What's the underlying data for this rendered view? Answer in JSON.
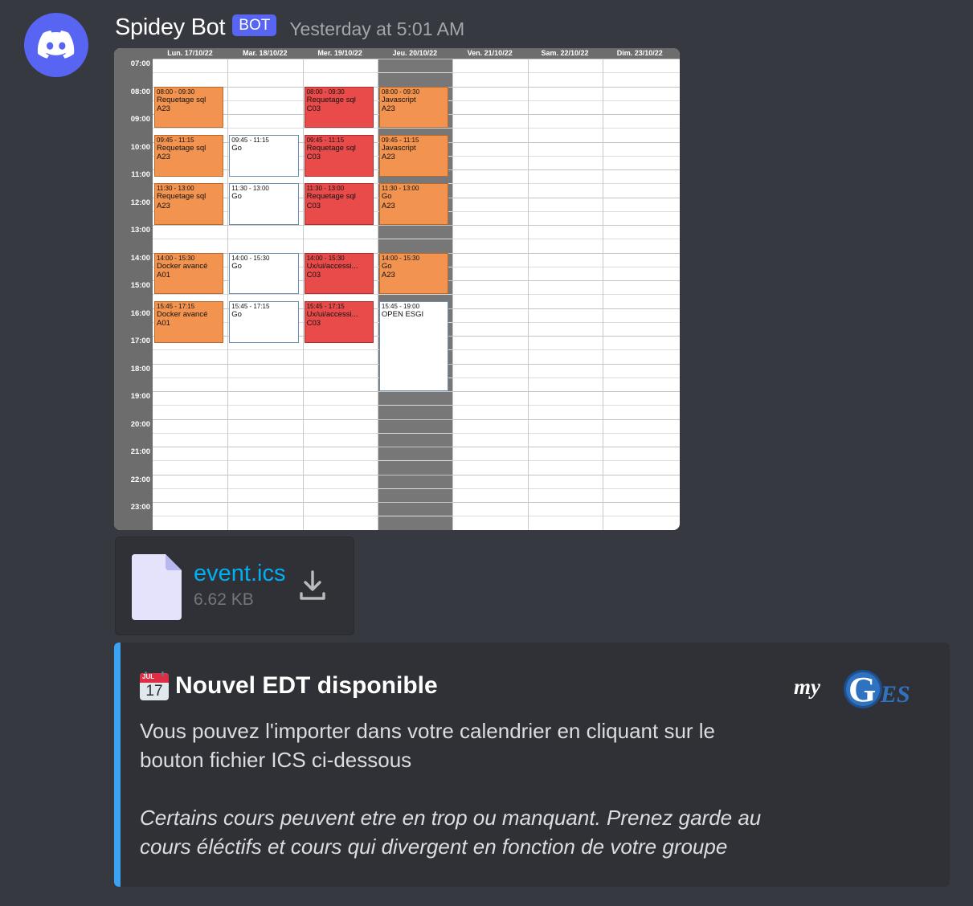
{
  "message": {
    "username": "Spidey Bot",
    "bot_tag": "BOT",
    "timestamp": "Yesterday at 5:01 AM",
    "avatar_icon": "discord-logo-icon"
  },
  "schedule": {
    "days": [
      "Lun. 17/10/22",
      "Mar. 18/10/22",
      "Mer. 19/10/22",
      "Jeu. 20/10/22",
      "Ven. 21/10/22",
      "Sam. 22/10/22",
      "Dim. 23/10/22"
    ],
    "hours": [
      "07:00",
      "08:00",
      "09:00",
      "10:00",
      "11:00",
      "12:00",
      "13:00",
      "14:00",
      "15:00",
      "16:00",
      "17:00",
      "18:00",
      "19:00",
      "20:00",
      "21:00",
      "22:00",
      "23:00"
    ],
    "events": [
      {
        "day": 0,
        "start": "08:00",
        "end": "09:30",
        "time": "08:00 - 09:30",
        "title": "Requetage sql",
        "room": "A23",
        "color": "orange"
      },
      {
        "day": 0,
        "start": "09:45",
        "end": "11:15",
        "time": "09:45 - 11:15",
        "title": "Requetage sql",
        "room": "A23",
        "color": "orange"
      },
      {
        "day": 0,
        "start": "11:30",
        "end": "13:00",
        "time": "11:30 - 13:00",
        "title": "Requetage sql",
        "room": "A23",
        "color": "orange"
      },
      {
        "day": 0,
        "start": "14:00",
        "end": "15:30",
        "time": "14:00 - 15:30",
        "title": "Docker avancé",
        "room": "A01",
        "color": "orange"
      },
      {
        "day": 0,
        "start": "15:45",
        "end": "17:15",
        "time": "15:45 - 17:15",
        "title": "Docker avancé",
        "room": "A01",
        "color": "orange"
      },
      {
        "day": 1,
        "start": "09:45",
        "end": "11:15",
        "time": "09:45 - 11:15",
        "title": "Go",
        "room": "",
        "color": "white"
      },
      {
        "day": 1,
        "start": "11:30",
        "end": "13:00",
        "time": "11:30 - 13:00",
        "title": "Go",
        "room": "",
        "color": "white"
      },
      {
        "day": 1,
        "start": "14:00",
        "end": "15:30",
        "time": "14:00 - 15:30",
        "title": "Go",
        "room": "",
        "color": "white"
      },
      {
        "day": 1,
        "start": "15:45",
        "end": "17:15",
        "time": "15:45 - 17:15",
        "title": "Go",
        "room": "",
        "color": "white"
      },
      {
        "day": 2,
        "start": "08:00",
        "end": "09:30",
        "time": "08:00 - 09:30",
        "title": "Requetage sql",
        "room": "C03",
        "color": "red"
      },
      {
        "day": 2,
        "start": "09:45",
        "end": "11:15",
        "time": "09:45 - 11:15",
        "title": "Requetage sql",
        "room": "C03",
        "color": "red"
      },
      {
        "day": 2,
        "start": "11:30",
        "end": "13:00",
        "time": "11:30 - 13:00",
        "title": "Requetage sql",
        "room": "C03",
        "color": "red"
      },
      {
        "day": 2,
        "start": "14:00",
        "end": "15:30",
        "time": "14:00 - 15:30",
        "title": "Ux/ui/accessi...",
        "room": "C03",
        "color": "red"
      },
      {
        "day": 2,
        "start": "15:45",
        "end": "17:15",
        "time": "15:45 - 17:15",
        "title": "Ux/ui/accessi...",
        "room": "C03",
        "color": "red"
      },
      {
        "day": 3,
        "start": "08:00",
        "end": "09:30",
        "time": "08:00 - 09:30",
        "title": "Javascript",
        "room": "A23",
        "color": "orange"
      },
      {
        "day": 3,
        "start": "09:45",
        "end": "11:15",
        "time": "09:45 - 11:15",
        "title": "Javascript",
        "room": "A23",
        "color": "orange"
      },
      {
        "day": 3,
        "start": "11:30",
        "end": "13:00",
        "time": "11:30 - 13:00",
        "title": "Go",
        "room": "A23",
        "color": "orange"
      },
      {
        "day": 3,
        "start": "14:00",
        "end": "15:30",
        "time": "14:00 - 15:30",
        "title": "Go",
        "room": "A23",
        "color": "orange"
      },
      {
        "day": 3,
        "start": "15:45",
        "end": "19:00",
        "time": "15:45 - 19:00",
        "title": "OPEN ESGI",
        "room": "",
        "color": "white"
      }
    ],
    "highlighted_day": 3
  },
  "attachment": {
    "file_name": "event.ics",
    "file_size": "6.62 KB",
    "file_icon": "file-icon",
    "download_icon": "download-icon"
  },
  "embed": {
    "emoji": "calendar-emoji-icon",
    "emoji_month": "JUL",
    "emoji_day": "17",
    "title": "Nouvel EDT disponible",
    "description": "Vous pouvez l'importer dans votre calendrier en cliquant sur le bouton fichier ICS ci-dessous",
    "note": "Certains cours peuvent etre en trop ou manquant. Prenez garde au cours éléctifs et cours qui divergent en fonction de votre groupe",
    "logo_text": "myGES",
    "accent_color": "#3ba3f3"
  },
  "colors": {
    "background": "#36393f",
    "embed_background": "#2f3136",
    "bot_tag": "#5865f2",
    "link": "#00aff4",
    "event_orange": "#f2934f",
    "event_red": "#e94b4b",
    "event_white": "#ffffff"
  }
}
